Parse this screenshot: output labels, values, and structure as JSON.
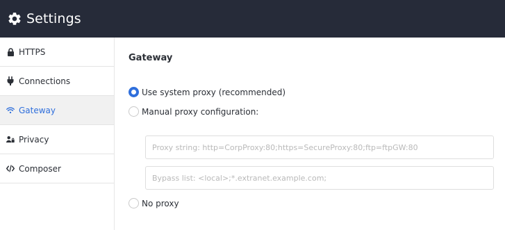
{
  "header": {
    "title": "Settings",
    "icon": "gear-icon"
  },
  "sidebar": {
    "items": [
      {
        "label": "HTTPS",
        "icon": "lock-icon"
      },
      {
        "label": "Connections",
        "icon": "plug-icon"
      },
      {
        "label": "Gateway",
        "icon": "wifi-icon",
        "active": true
      },
      {
        "label": "Privacy",
        "icon": "user-lock-icon"
      },
      {
        "label": "Composer",
        "icon": "code-icon"
      }
    ]
  },
  "main": {
    "section_title": "Gateway",
    "options": {
      "system_proxy": {
        "label": "Use system proxy (recommended)",
        "selected": true
      },
      "manual_proxy": {
        "label": "Manual proxy configuration:",
        "selected": false
      },
      "no_proxy": {
        "label": "No proxy",
        "selected": false
      }
    },
    "proxy_string": {
      "value": "",
      "placeholder": "Proxy string: http=CorpProxy:80;https=SecureProxy:80;ftp=ftpGW:80"
    },
    "bypass_list": {
      "value": "",
      "placeholder": "Bypass list: <local>;*.extranet.example.com;"
    }
  },
  "colors": {
    "header_bg": "#262b39",
    "accent": "#2f6fdc",
    "active_bg": "#f1f1f1"
  }
}
